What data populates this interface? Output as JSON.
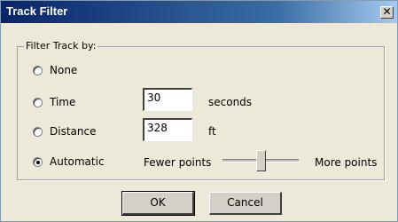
{
  "window": {
    "title": "Track Filter",
    "close_glyph": "✕"
  },
  "group": {
    "legend": "Filter Track by:"
  },
  "options": [
    {
      "label": "None",
      "checked": false
    },
    {
      "label": "Time",
      "checked": false
    },
    {
      "label": "Distance",
      "checked": false
    },
    {
      "label": "Automatic",
      "checked": true
    }
  ],
  "time": {
    "value": "30",
    "unit": "seconds"
  },
  "distance": {
    "value": "328",
    "unit": "ft"
  },
  "slider": {
    "min_label": "Fewer points",
    "max_label": "More points",
    "value_fraction": 0.5
  },
  "buttons": {
    "ok": "OK",
    "cancel": "Cancel"
  }
}
